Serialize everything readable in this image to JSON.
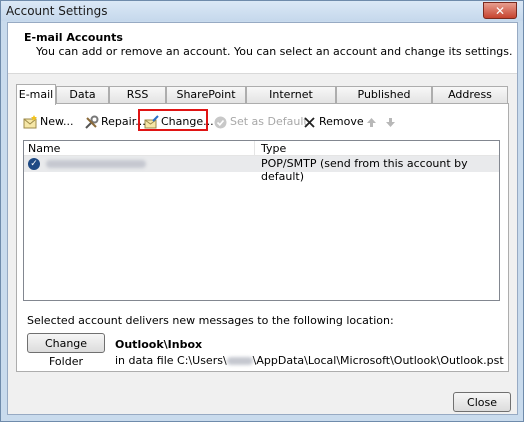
{
  "window": {
    "title": "Account Settings",
    "close_glyph": "✕"
  },
  "header": {
    "title": "E-mail Accounts",
    "subtitle": "You can add or remove an account. You can select an account and change its settings."
  },
  "tabs": [
    {
      "label": "E-mail",
      "active": true
    },
    {
      "label": "Data Files"
    },
    {
      "label": "RSS Feeds"
    },
    {
      "label": "SharePoint Lists"
    },
    {
      "label": "Internet Calendars"
    },
    {
      "label": "Published Calendars"
    },
    {
      "label": "Address Books"
    }
  ],
  "toolbar": {
    "new_label": "New...",
    "repair_label": "Repair...",
    "change_label": "Change...",
    "set_default_label": "Set as Default",
    "remove_label": "Remove"
  },
  "accounts_list": {
    "col_name": "Name",
    "col_type": "Type",
    "rows": [
      {
        "type": "POP/SMTP (send from this account by default)"
      }
    ]
  },
  "delivery": {
    "label": "Selected account delivers new messages to the following location:",
    "change_folder_label": "Change Folder",
    "folder": "Outlook\\Inbox",
    "data_file_prefix": "in data file C:\\Users\\",
    "data_file_suffix": "\\AppData\\Local\\Microsoft\\Outlook\\Outlook.pst"
  },
  "footer": {
    "close_label": "Close"
  },
  "colors": {
    "highlight": "#e01414",
    "selected_row": "#e9eaec",
    "accent": "#1f4a84"
  },
  "icons": [
    "new-account-icon",
    "repair-icon",
    "change-icon",
    "set-default-icon",
    "remove-icon",
    "move-up-icon",
    "move-down-icon",
    "default-account-check-icon"
  ]
}
